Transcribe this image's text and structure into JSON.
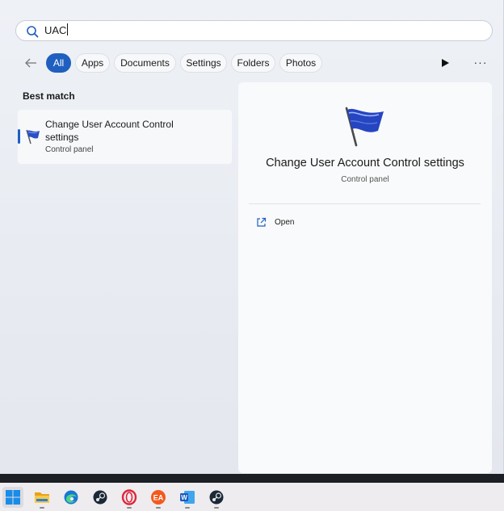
{
  "search": {
    "query": "UAC"
  },
  "filters": {
    "chips": [
      {
        "label": "All",
        "active": true
      },
      {
        "label": "Apps",
        "active": false
      },
      {
        "label": "Documents",
        "active": false
      },
      {
        "label": "Settings",
        "active": false
      },
      {
        "label": "Folders",
        "active": false
      },
      {
        "label": "Photos",
        "active": false
      }
    ],
    "more_label": "···"
  },
  "results": {
    "section_label": "Best match",
    "best_match": {
      "title": "Change User Account Control settings",
      "subtitle": "Control panel"
    }
  },
  "detail": {
    "title": "Change User Account Control settings",
    "subtitle": "Control panel",
    "actions": [
      {
        "label": "Open",
        "icon": "open-external-icon"
      }
    ]
  },
  "taskbar": {
    "apps": [
      {
        "name": "start",
        "icon": "windows-start-icon"
      },
      {
        "name": "file-explorer",
        "icon": "folder-icon"
      },
      {
        "name": "edge",
        "icon": "edge-icon"
      },
      {
        "name": "steam",
        "icon": "steam-icon"
      },
      {
        "name": "opera",
        "icon": "opera-icon"
      },
      {
        "name": "ea",
        "icon": "ea-icon",
        "label": "EA"
      },
      {
        "name": "word",
        "icon": "word-icon",
        "label": "W"
      },
      {
        "name": "steam-2",
        "icon": "steam-icon"
      }
    ]
  },
  "colors": {
    "accent": "#1f5fbf",
    "panel_bg": "#eef1f6",
    "detail_bg": "#f9fafb",
    "taskbar_bg": "#eeecef"
  }
}
